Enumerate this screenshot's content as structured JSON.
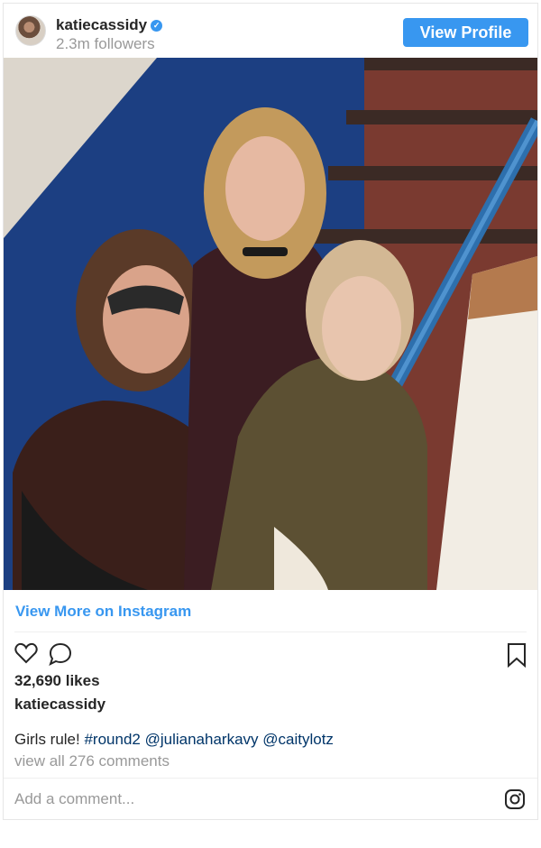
{
  "header": {
    "username": "katiecassidy",
    "followers": "2.3m followers",
    "view_profile_label": "View Profile"
  },
  "links": {
    "view_more": "View More on Instagram"
  },
  "post": {
    "likes": "32,690 likes",
    "author": "katiecassidy",
    "caption_text": "Girls rule! ",
    "caption_tags": [
      "#round2",
      "@julianaharkavy",
      "@caitylotz"
    ],
    "view_comments": "view all 276 comments",
    "add_comment_placeholder": "Add a comment..."
  },
  "icons": [
    "verified-badge-icon",
    "heart-icon",
    "comment-icon",
    "bookmark-icon",
    "instagram-icon"
  ],
  "colors": {
    "accent": "#3897f0",
    "hashtag": "#003569",
    "muted": "#999999"
  }
}
